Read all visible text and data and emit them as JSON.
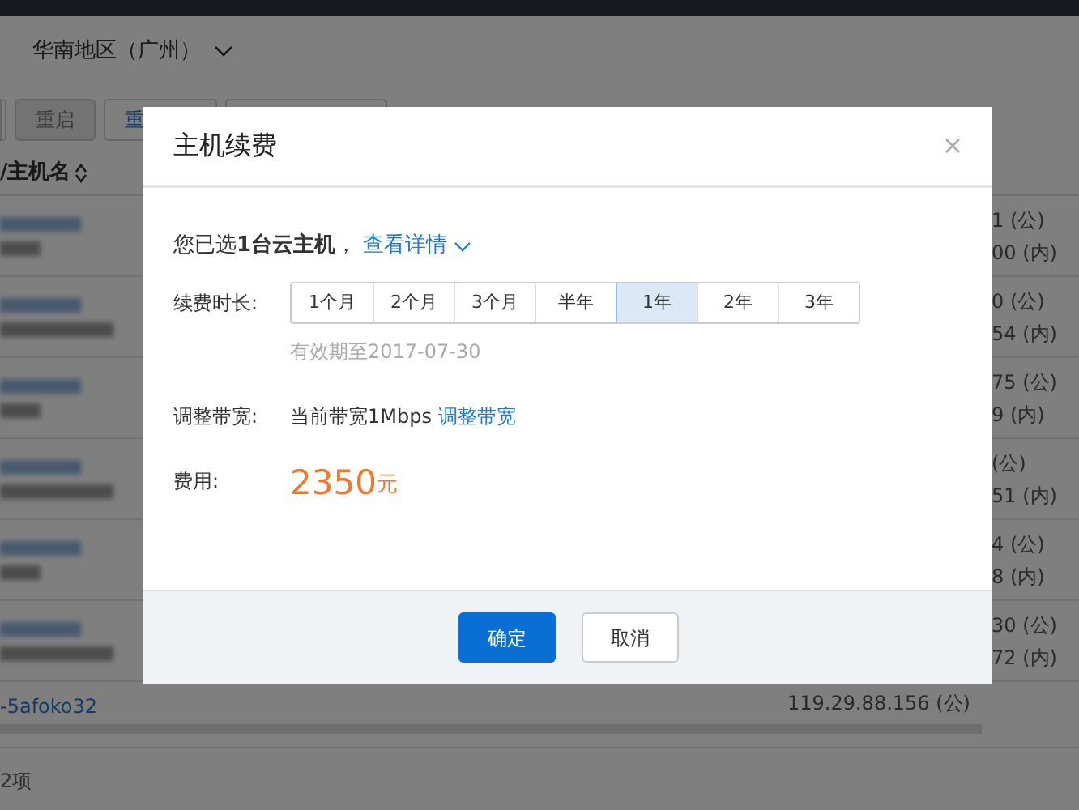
{
  "region_selector": {
    "label": "华南地区（广州）"
  },
  "toolbar": {
    "buttons": [
      {
        "label": "重启",
        "disabled": true
      },
      {
        "label": "重",
        "disabled": false
      }
    ]
  },
  "table": {
    "header": "/主机名",
    "rows": [
      {
        "ip_public": "1 (公)",
        "ip_private": "00 (内)"
      },
      {
        "ip_public": "0 (公)",
        "ip_private": "54 (内)"
      },
      {
        "ip_public": "75 (公)",
        "ip_private": "9 (内)"
      },
      {
        "ip_public": "(公)",
        "ip_private": "51 (内)"
      },
      {
        "ip_public": "4 (公)",
        "ip_private": "8 (内)"
      },
      {
        "ip_public": "30 (公)",
        "ip_private": "72 (内)"
      },
      {
        "name": "-5afoko32",
        "ip_public": "119.29.88.156 (公)"
      }
    ]
  },
  "footer": {
    "count": "2项"
  },
  "dialog": {
    "title": "主机续费",
    "selection": "您已选**1台云主机**，",
    "details_link": "查看详情",
    "duration_label": "续费时长:",
    "durations": [
      {
        "label": "1个月",
        "selected": false
      },
      {
        "label": "2个月",
        "selected": false
      },
      {
        "label": "3个月",
        "selected": false
      },
      {
        "label": "半年",
        "selected": false
      },
      {
        "label": "1年",
        "selected": true
      },
      {
        "label": "2年",
        "selected": false
      },
      {
        "label": "3年",
        "selected": false
      }
    ],
    "expiry": "有效期至2017-07-30",
    "bandwidth_label": "调整带宽:",
    "bandwidth_current": "当前带宽1Mbps",
    "bandwidth_link": "调整带宽",
    "cost_label": "费用:",
    "amount": "2350",
    "unit": "元",
    "confirm": "确定",
    "cancel": "取消"
  }
}
